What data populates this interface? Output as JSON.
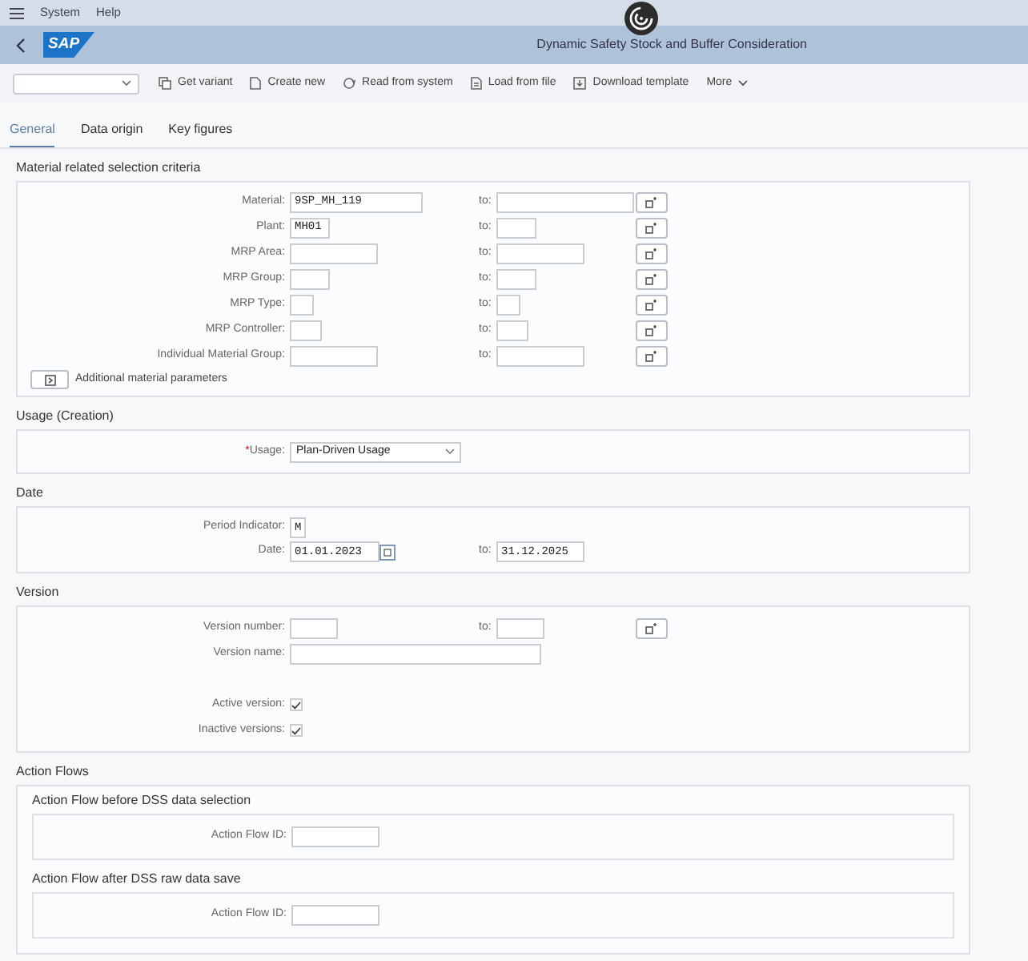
{
  "menu_bar": {
    "items": [
      {
        "label": "System"
      },
      {
        "label": "Help"
      }
    ]
  },
  "header": {
    "logo": "SAP",
    "title": "Dynamic Safety Stock and Buffer Consideration"
  },
  "toolbar": {
    "buttons": [
      {
        "kind": "copy",
        "label": "Get variant"
      },
      {
        "kind": "page",
        "label": "Create new"
      },
      {
        "kind": "sync",
        "label": "Read from system"
      },
      {
        "kind": "file",
        "label": "Load from file"
      },
      {
        "kind": "download",
        "label": "Download template"
      },
      {
        "kind": "more",
        "label": "More"
      }
    ]
  },
  "tabs": [
    {
      "label": "General",
      "selected": true
    },
    {
      "label": "Data origin",
      "selected": false
    },
    {
      "label": "Key figures",
      "selected": false
    }
  ],
  "material_criteria": {
    "title": "Material related selection criteria",
    "rows": [
      {
        "label": "Material:",
        "value": "9SP_MH_119",
        "to_label": "to:"
      },
      {
        "label": "Plant:",
        "value": "MH01",
        "to_label": "to:"
      },
      {
        "label": "MRP Area:",
        "to_label": "to:"
      },
      {
        "label": "MRP Group:",
        "to_label": "to:"
      },
      {
        "label": "MRP Type:",
        "to_label": "to:"
      },
      {
        "label": "MRP Controller:",
        "to_label": "to:"
      },
      {
        "label": "Individual Material Group:",
        "to_label": "to:"
      }
    ],
    "additional_button": "Additional material parameters"
  },
  "usage": {
    "title": "Usage (Creation)",
    "required_mark": "*",
    "label": "Usage:",
    "value": "Plan-Driven Usage"
  },
  "date": {
    "title": "Date",
    "period_label": "Period Indicator:",
    "period_value": "M",
    "date_label": "Date:",
    "date_from": "01.01.2023",
    "focused": true,
    "to_label": "to:",
    "date_to": "31.12.2025"
  },
  "version": {
    "title": "Version",
    "number_label": "Version number:",
    "to_label": "to:",
    "name_label": "Version name:",
    "checks": [
      {
        "label": "Active version:",
        "checked": true
      },
      {
        "label": "Inactive versions:",
        "checked": true
      }
    ]
  },
  "action_flows": {
    "title": "Action Flows",
    "groups": [
      {
        "title": "Action Flow before DSS data selection",
        "label": "Action Flow ID:"
      },
      {
        "title": "Action Flow after DSS raw data save",
        "label": "Action Flow ID:"
      }
    ]
  }
}
